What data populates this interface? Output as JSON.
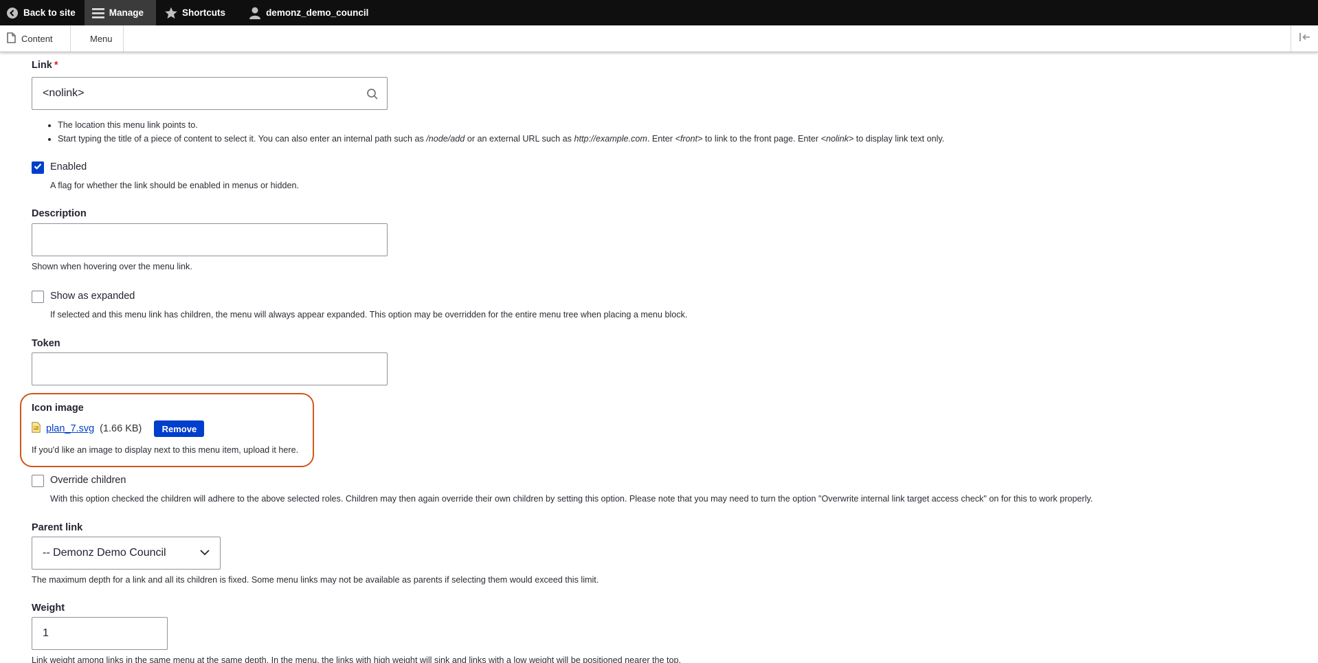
{
  "toolbar": {
    "back_to_site": "Back to site",
    "manage": "Manage",
    "shortcuts": "Shortcuts",
    "user": "demonz_demo_council"
  },
  "tray": {
    "content": "Content",
    "menu": "Menu"
  },
  "link_field": {
    "label": "Link",
    "required_marker": "*",
    "value": "<nolink>",
    "help_1": "The location this menu link points to.",
    "help_2_a": "Start typing the title of a piece of content to select it. You can also enter an internal path such as ",
    "help_2_node": "/node/add",
    "help_2_b": " or an external URL such as ",
    "help_2_url": "http://example.com",
    "help_2_c": ". Enter ",
    "help_2_front": "<front>",
    "help_2_d": " to link to the front page. Enter ",
    "help_2_nolink": "<nolink>",
    "help_2_e": " to display link text only."
  },
  "enabled": {
    "label": "Enabled",
    "checked": true,
    "help": "A flag for whether the link should be enabled in menus or hidden."
  },
  "description": {
    "label": "Description",
    "value": "",
    "help": "Shown when hovering over the menu link."
  },
  "expanded": {
    "label": "Show as expanded",
    "checked": false,
    "help": "If selected and this menu link has children, the menu will always appear expanded. This option may be overridden for the entire menu tree when placing a menu block."
  },
  "token": {
    "label": "Token",
    "value": ""
  },
  "icon_image": {
    "label": "Icon image",
    "file_name": "plan_7.svg",
    "file_size": "(1.66 KB)",
    "remove_label": "Remove",
    "help": "If you'd like an image to display next to this menu item, upload it here.",
    "highlight_color": "#d2541a"
  },
  "override_children": {
    "label": "Override children",
    "checked": false,
    "help": "With this option checked the children will adhere to the above selected roles. Children may then again override their own children by setting this option. Please note that you may need to turn the option \"Overwrite internal link target access check\" on for this to work properly."
  },
  "parent_link": {
    "label": "Parent link",
    "selected": "-- Demonz Demo Council",
    "help": "The maximum depth for a link and all its children is fixed. Some menu links may not be available as parents if selecting them would exceed this limit."
  },
  "weight": {
    "label": "Weight",
    "value": "1",
    "help": "Link weight among links in the same menu at the same depth. In the menu, the links with high weight will sink and links with a low weight will be positioned nearer the top."
  },
  "colors": {
    "accent": "#003ecc",
    "toolbar_bg": "#0f0f0f",
    "required": "#dc2323"
  }
}
